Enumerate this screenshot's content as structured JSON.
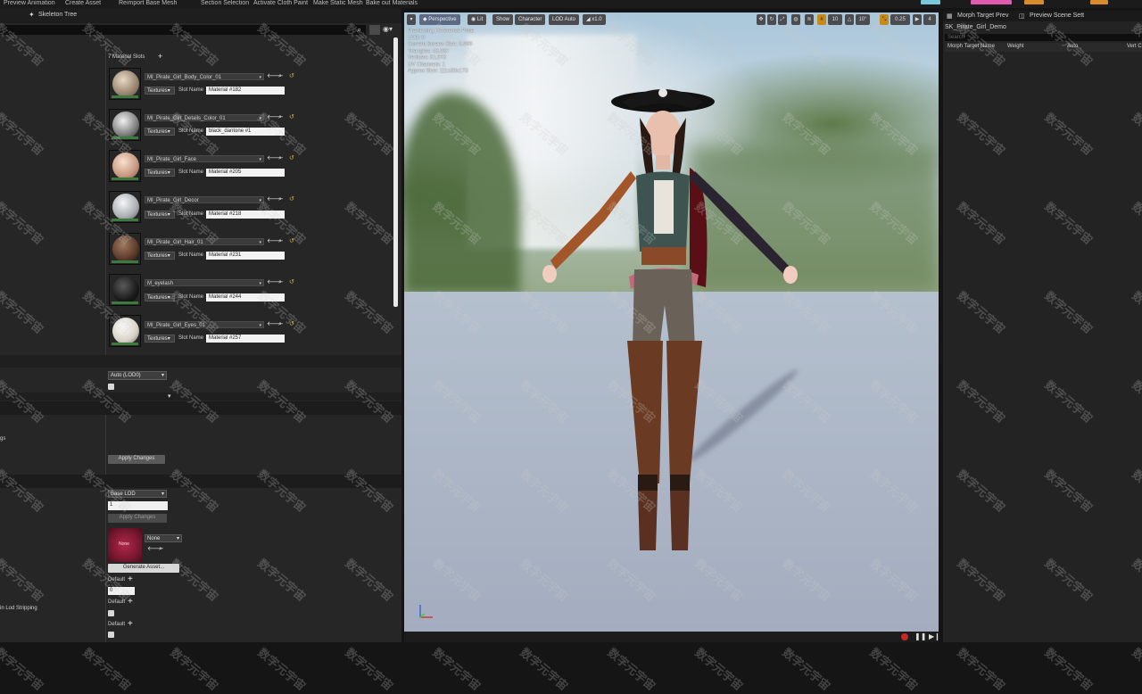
{
  "toolbar": {
    "items": [
      "Preview Animation",
      "Create Asset",
      "Reimport Base Mesh",
      "Section Selection",
      "Activate Cloth Paint",
      "Make Static Mesh",
      "Bake out Materials"
    ],
    "accent_colors": [
      "#e05ab0",
      "#d98a2a",
      "#7ac9d8"
    ]
  },
  "left_panel": {
    "tab_label": "Skeleton Tree",
    "material_slots_label": "7 Material Slots",
    "add_icon": "plus-icon",
    "materials": [
      {
        "name": "MI_Pirate_Girl_Body_Color_01",
        "textures_label": "Textures",
        "slot_label": "Slot Name",
        "slot_name": "Material #182",
        "thumb_color": "#b8a58e"
      },
      {
        "name": "MI_Pirate_Girl_Details_Color_01",
        "textures_label": "Textures",
        "slot_label": "Slot Name",
        "slot_name": "black_dantone #1",
        "thumb_color": "#a6a6a6"
      },
      {
        "name": "MI_Pirate_Girl_Face",
        "textures_label": "Textures",
        "slot_label": "Slot Name",
        "slot_name": "Material #205",
        "thumb_color": "#d9b09c"
      },
      {
        "name": "MI_Pirate_Girl_Decor",
        "textures_label": "Textures",
        "slot_label": "Slot Name",
        "slot_name": "Material #218",
        "thumb_color": "#c6c9cc"
      },
      {
        "name": "MI_Pirate_Girl_Hair_01",
        "textures_label": "Textures",
        "slot_label": "Slot Name",
        "slot_name": "Material #231",
        "thumb_color": "#6a4a3a"
      },
      {
        "name": "M_eyelash",
        "textures_label": "Textures",
        "slot_label": "Slot Name",
        "slot_name": "Material #244",
        "thumb_color": "#1e1e1e"
      },
      {
        "name": "MI_Pirate_Girl_Eyes_01",
        "textures_label": "Textures",
        "slot_label": "Slot Name",
        "slot_name": "Material #257",
        "thumb_color": "#e6e2d8"
      }
    ],
    "lod_select": "Auto (LOD0)",
    "apply_changes_1": "Apply Changes",
    "base_lod_select": "Base LOD",
    "base_lod_value": "1",
    "apply_changes_2": "Apply Changes",
    "thumb_none_label": "None",
    "none_select": "None",
    "generate_asset": "Generate Asset...",
    "default_1": "Default",
    "default_value": "0",
    "default_2": "Default",
    "default_3": "Default",
    "label_gs": "gs",
    "label_lod_stripping": "in Lod Stripping"
  },
  "viewport": {
    "perspective": "Perspective",
    "lit": "Lit",
    "show": "Show",
    "character": "Character",
    "lod": "LOD Auto",
    "speed": "x1.0",
    "grid_snap": "10",
    "rot_snap": "10°",
    "scale_snap": "0.25",
    "cam_speed": "4",
    "stats": [
      "Previewing Reference Pose",
      "LOD: 0",
      "Current Screen Size: 0.999",
      "Triangles: 43,937",
      "Vertices: 31,573",
      "UV Channels: 1",
      "Approx Size: 111x30x173"
    ]
  },
  "right_panel": {
    "tab_morph": "Morph Target Prev",
    "tab_scene": "Preview Scene Sett",
    "asset_name": "SK_Pirate_Girl_Demo",
    "search_placeholder": "Search",
    "columns": [
      "Morph Target Name",
      "Weight",
      "Auto",
      "Vert C"
    ]
  },
  "watermark": "数字元宇宙"
}
